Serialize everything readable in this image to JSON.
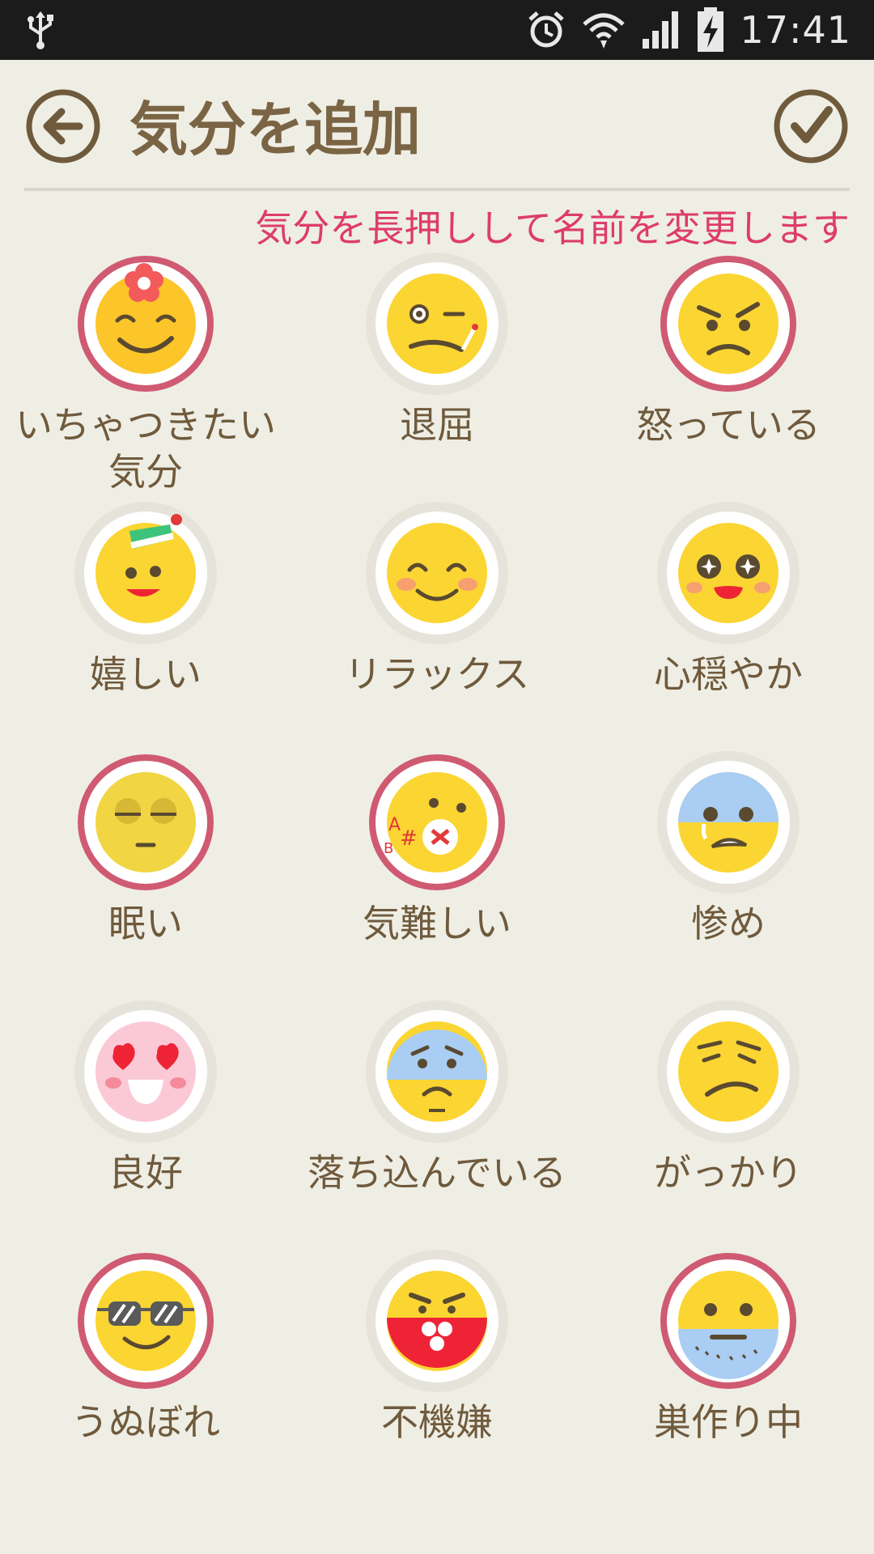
{
  "status_bar": {
    "time": "17:41",
    "icons": [
      "usb-icon",
      "alarm-icon",
      "wifi-icon",
      "signal-icon",
      "battery-charging-icon"
    ]
  },
  "header": {
    "title": "気分を追加",
    "back_icon": "arrow-left-circle-icon",
    "confirm_icon": "check-circle-icon"
  },
  "hint": "気分を長押しして名前を変更します",
  "colors": {
    "background": "#efeee5",
    "title": "#7a6444",
    "hint": "#dd3c6b",
    "selected_ring": "#cf5a72",
    "face_yellow": "#fbd532"
  },
  "moods": [
    {
      "label": "いちゃつきたい気分",
      "selected": true,
      "icon": "flirty-face-icon"
    },
    {
      "label": "退屈",
      "selected": false,
      "icon": "bored-face-icon"
    },
    {
      "label": "怒っている",
      "selected": true,
      "icon": "angry-face-icon"
    },
    {
      "label": "嬉しい",
      "selected": false,
      "icon": "happy-face-icon"
    },
    {
      "label": "リラックス",
      "selected": false,
      "icon": "relaxed-face-icon"
    },
    {
      "label": "心穏やか",
      "selected": false,
      "icon": "calm-face-icon"
    },
    {
      "label": "眠い",
      "selected": true,
      "icon": "sleepy-face-icon"
    },
    {
      "label": "気難しい",
      "selected": true,
      "icon": "grumpy-face-icon"
    },
    {
      "label": "惨め",
      "selected": false,
      "icon": "miserable-face-icon"
    },
    {
      "label": "良好",
      "selected": false,
      "icon": "love-face-icon"
    },
    {
      "label": "落ち込んでいる",
      "selected": false,
      "icon": "depressed-face-icon"
    },
    {
      "label": "がっかり",
      "selected": false,
      "icon": "disappointed-face-icon"
    },
    {
      "label": "うぬぼれ",
      "selected": true,
      "icon": "cool-face-icon"
    },
    {
      "label": "不機嫌",
      "selected": false,
      "icon": "moody-face-icon"
    },
    {
      "label": "巣作り中",
      "selected": true,
      "icon": "nesting-face-icon"
    }
  ]
}
